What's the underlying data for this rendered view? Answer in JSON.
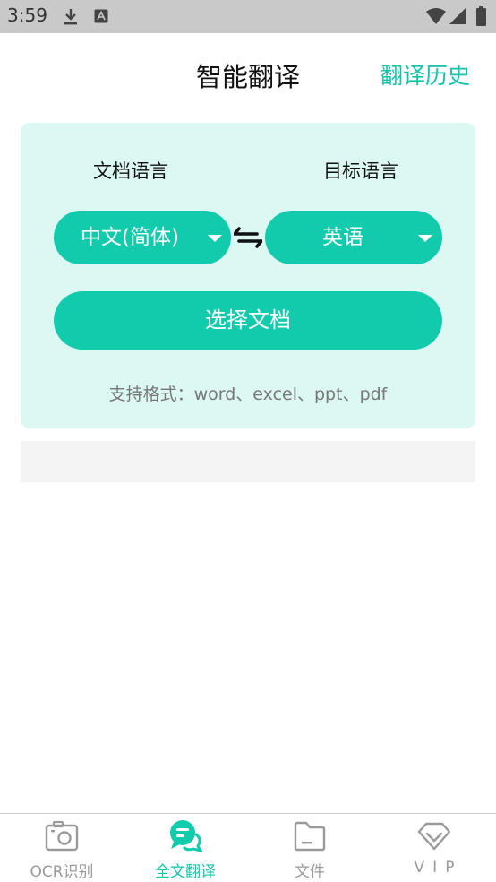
{
  "status_bar": {
    "time": "3:59"
  },
  "header": {
    "title": "智能翻译",
    "history_label": "翻译历史"
  },
  "card": {
    "source_label": "文档语言",
    "target_label": "目标语言",
    "source_language": "中文(简体)",
    "target_language": "英语",
    "choose_button": "选择文档",
    "formats_text": "支持格式：word、excel、ppt、pdf"
  },
  "tabs": [
    {
      "label": "OCR识别",
      "icon": "camera-icon"
    },
    {
      "label": "全文翻译",
      "icon": "chat-bubbles-icon",
      "active": true
    },
    {
      "label": "文件",
      "icon": "folder-icon"
    },
    {
      "label": "VIP",
      "icon": "diamond-icon"
    }
  ],
  "colors": {
    "accent": "#12cbad",
    "card_bg": "#dcf8f3",
    "status_bar": "#c9c9c9"
  }
}
